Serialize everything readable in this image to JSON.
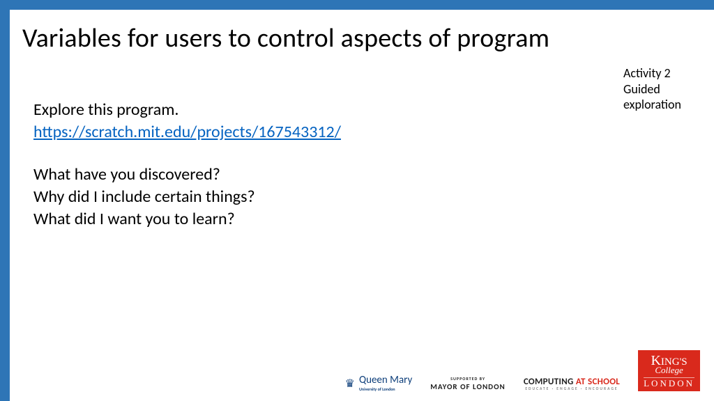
{
  "title": "Variables for users to control aspects of program",
  "activity": {
    "line1": "Activity 2",
    "line2": "Guided",
    "line3": "exploration"
  },
  "body": {
    "intro": "Explore this program.",
    "link": "https://scratch.mit.edu/projects/167543312/",
    "q1": "What have you discovered?",
    "q2": "Why did I include certain things?",
    "q3": "What did I want you to learn?"
  },
  "logos": {
    "queenmary": {
      "main": "Queen Mary",
      "sub": "University of London",
      "icon": "♛"
    },
    "mayor": {
      "sup": "SUPPORTED BY",
      "main": "MAYOR OF LONDON"
    },
    "cas": {
      "w1": "COMPUTING ",
      "w2": "AT SCHOOL",
      "sub": "EDUCATE · ENGAGE · ENCOURAGE"
    },
    "kcl": {
      "k": "K",
      "ings": "ING'S",
      "college": "College",
      "london": "LONDON"
    }
  }
}
